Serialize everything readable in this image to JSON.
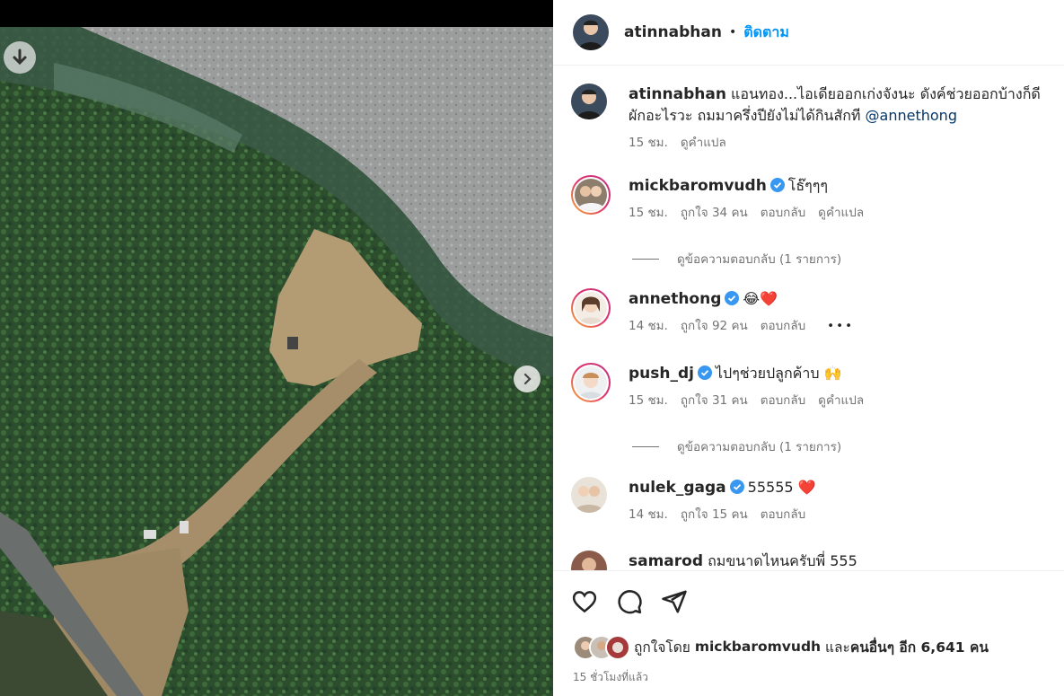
{
  "post": {
    "author": "atinnabhan",
    "follow_label": "ติดตาม",
    "caption_text": "แอนทอง...ไอเดียออกเก่งจังนะ ดังค์ช่วยออกบ้างก็ดี ผักอะไรวะ ถมมาครึ่งปียังไม่ได้กินสักที",
    "caption_mention": "@annethong",
    "caption_time": "15 ชม.",
    "translate_label": "ดูคำแปล"
  },
  "comments": [
    {
      "user": "mickbaromvudh",
      "verified": true,
      "text": "โธ๊ๆๆๆ",
      "time": "15 ชม.",
      "likes": "ถูกใจ 34 คน",
      "reply": "ตอบกลับ",
      "translate": "ดูคำแปล",
      "view_replies": "ดูข้อความตอบกลับ (1 รายการ)"
    },
    {
      "user": "annethong",
      "verified": true,
      "text": "😂❤️",
      "time": "14 ชม.",
      "likes": "ถูกใจ 92 คน",
      "reply": "ตอบกลับ",
      "more": "•••"
    },
    {
      "user": "push_dj",
      "verified": true,
      "text": "ไปๆช่วยปลูกค้าบ 🙌",
      "time": "15 ชม.",
      "likes": "ถูกใจ 31 คน",
      "reply": "ตอบกลับ",
      "translate": "ดูคำแปล",
      "view_replies": "ดูข้อความตอบกลับ (1 รายการ)"
    },
    {
      "user": "nulek_gaga",
      "verified": true,
      "text": "55555 ❤️",
      "time": "14 ชม.",
      "likes": "ถูกใจ 15 คน",
      "reply": "ตอบกลับ"
    },
    {
      "user": "samarod",
      "verified": false,
      "text": "ถมขนาดไหนครับพี่ 555"
    }
  ],
  "likes_summary": {
    "prefix": "ถูกใจโดย",
    "user": "mickbaromvudh",
    "and": "และ",
    "others": "คนอื่นๆ อีก 6,641 คน"
  },
  "post_time": "15 ชั่วโมงที่แล้ว",
  "colors": {
    "accent": "#0095f6",
    "verified": "#3897f0",
    "text": "#262626",
    "muted": "#737373"
  }
}
